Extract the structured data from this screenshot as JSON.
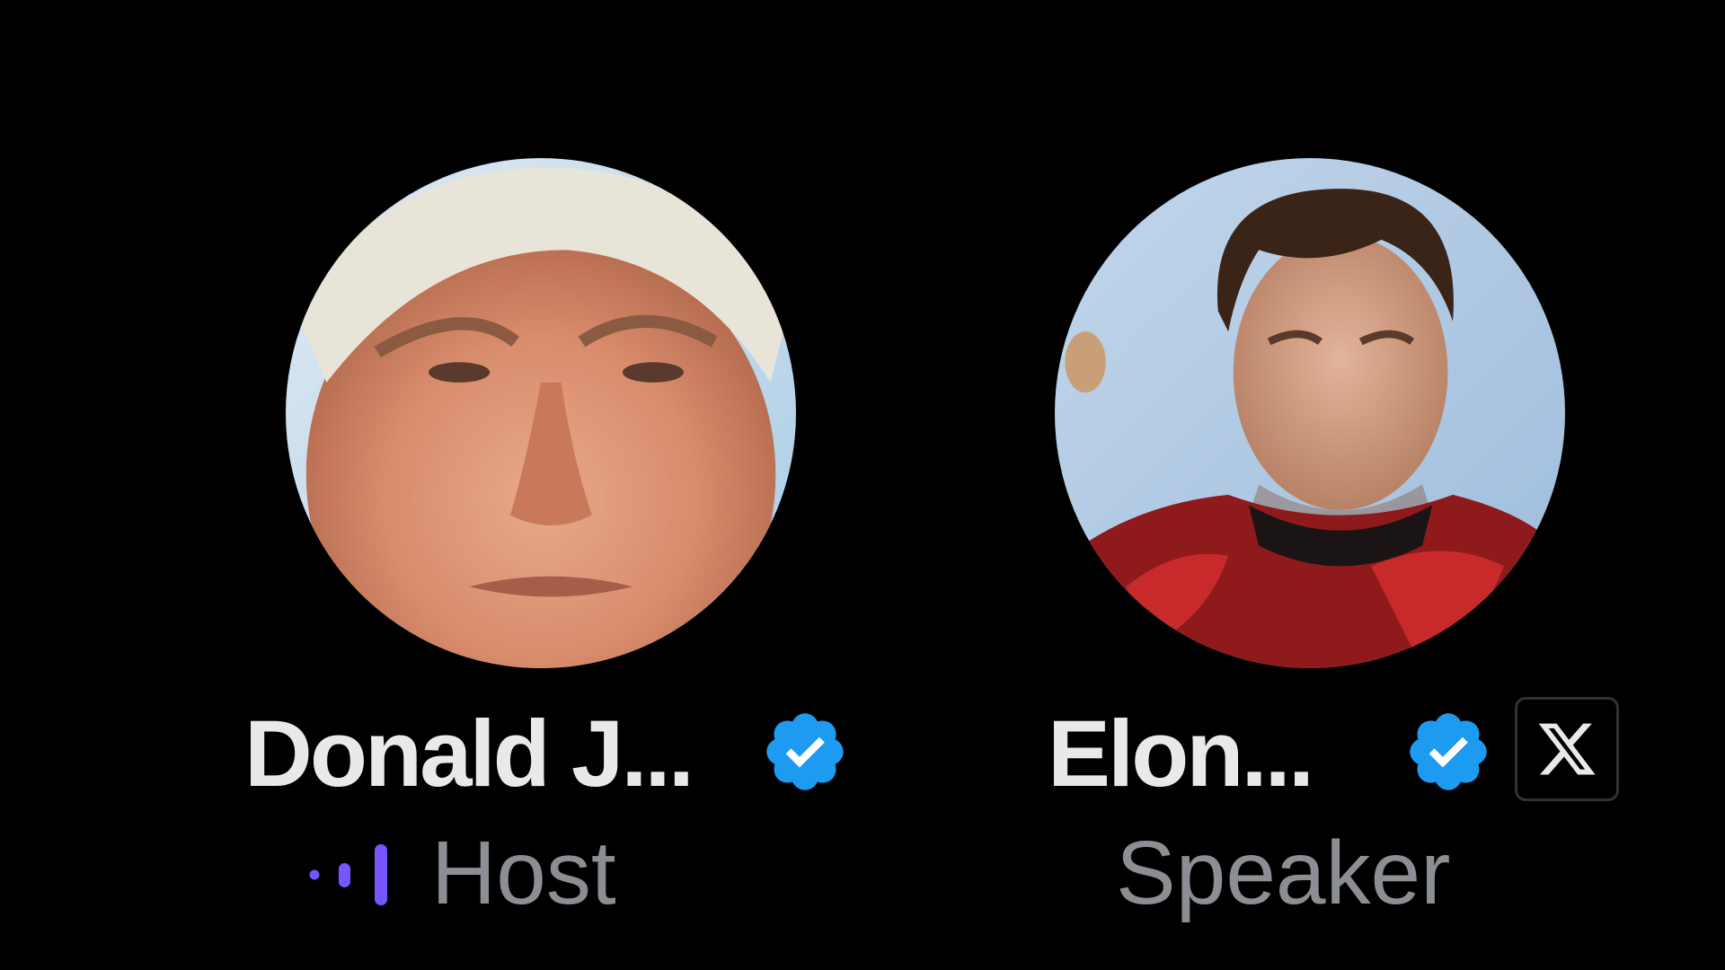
{
  "participants": [
    {
      "name": "Donald J...",
      "role": "Host",
      "verified": true,
      "speaking_indicator": "audio-bars-icon",
      "accent": "#7856ff"
    },
    {
      "name": "Elon...",
      "role": "Speaker",
      "verified": true,
      "badge": "x-logo-icon"
    }
  ],
  "colors": {
    "background": "#000000",
    "name_text": "#e7e9ea",
    "role_text": "#8b8f94",
    "verified_blue": "#1d9bf0",
    "speaking_purple": "#7856ff"
  }
}
